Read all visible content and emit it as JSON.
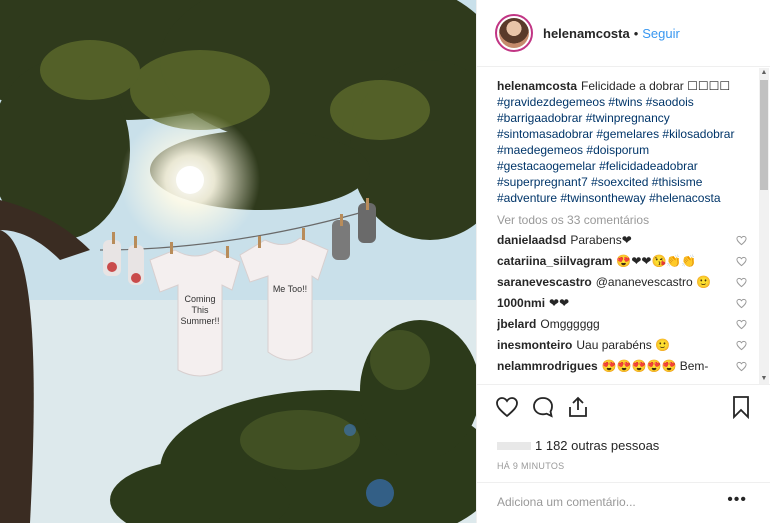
{
  "post": {
    "username": "helenamcosta",
    "follow_label": "Seguir",
    "separator": "•"
  },
  "photo": {
    "onesie_left_text": "Coming\nThis\nSummer!!",
    "onesie_left_lines": [
      "Coming",
      "This",
      "Summer!!"
    ],
    "onesie_right_text": "Me Too!!"
  },
  "caption": {
    "username": "helenamcosta",
    "text": "Felicidade a dobrar ☐☐☐☐",
    "hashtags": "#gravidezdegemeos #twins #saodois #barrigaadobrar #twinpregnancy #sintomasadobrar #gemelares #kilosadobrar #maedegemeos #doisporum #gestacaogemelar #felicidadeadobrar #superpregnant7 #soexcited #thisisme #adventure #twinsontheway #helenacosta"
  },
  "view_all": "Ver todos os 33 comentários",
  "comments": [
    {
      "user": "danielaadsd",
      "text": "Parabens❤"
    },
    {
      "user": "catariina_siilvagram",
      "text": "😍❤❤😘👏👏"
    },
    {
      "user": "saranevescastro",
      "text": "@ananevescastro 🙂"
    },
    {
      "user": "1000nmi",
      "text": "❤❤"
    },
    {
      "user": "jbelard",
      "text": "Omgggggg"
    },
    {
      "user": "inesmonteiro",
      "text": "Uau parabéns 🙂"
    },
    {
      "user": "nelammrodrigues",
      "text": "😍😍😍😍😍 Bem-"
    }
  ],
  "likes": {
    "text": "1 182 outras pessoas"
  },
  "timestamp": "HÁ 9 MINUTOS",
  "add_comment_placeholder": "Adiciona um comentário...",
  "more_label": "•••",
  "icons": [
    "heart-icon",
    "comment-icon",
    "share-icon",
    "bookmark-icon",
    "more-options-icon"
  ],
  "colors": {
    "link": "#3897f0",
    "hashtag": "#003569",
    "muted": "#999999",
    "text": "#262626"
  }
}
